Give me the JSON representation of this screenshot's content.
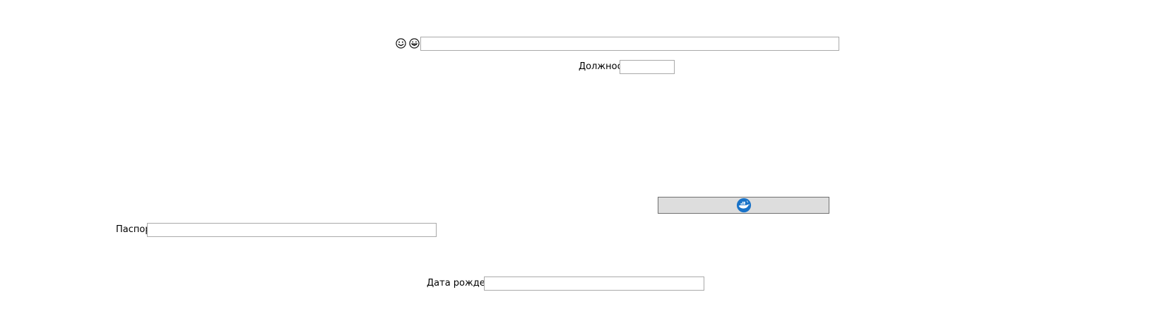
{
  "top_row": {
    "emoji_1_icon": "smile-with-tongue-icon",
    "emoji_2_icon": "grinning-face-icon",
    "text_value": ""
  },
  "position_field": {
    "label": "Должность",
    "value": ""
  },
  "action_button": {
    "icon": "whale-logo-icon",
    "accent_color": "#1a73c8"
  },
  "passport_field": {
    "label": "Паспорт",
    "value": ""
  },
  "birthdate_field": {
    "label": "Дата рождения",
    "value": ""
  }
}
